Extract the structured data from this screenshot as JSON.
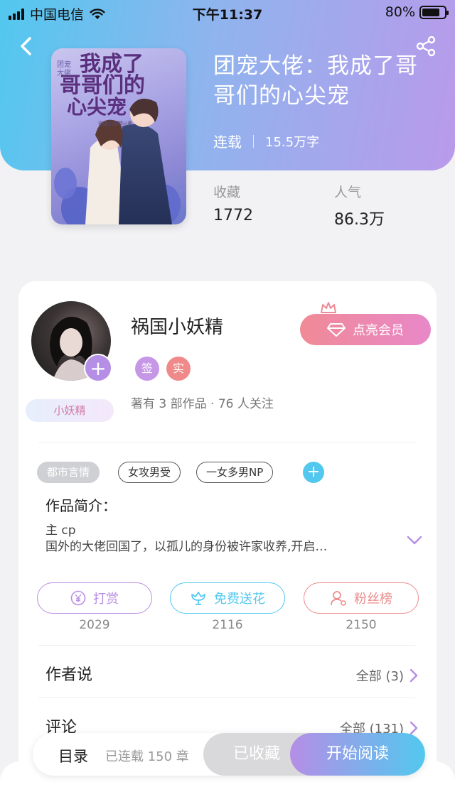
{
  "status_bar": {
    "carrier": "中国电信",
    "time": "下午11:37",
    "battery": "80%",
    "battery_level": 0.8
  },
  "book": {
    "title": "团宠大佬：我成了哥哥们的心尖宠",
    "status": "连载",
    "word_count": "15.5万字",
    "stats": {
      "favorites_label": "收藏",
      "favorites_value": "1772",
      "popularity_label": "人气",
      "popularity_value": "86.3万"
    }
  },
  "author": {
    "name": "祸国小妖精",
    "badge": "小妖精",
    "tag_sign": "签",
    "tag_real": "实",
    "info": "著有 3 部作品 · 76 人关注",
    "vip_button": "点亮会员"
  },
  "tags": [
    "都市言情",
    "女攻男受",
    "一女多男NP"
  ],
  "synopsis": {
    "title": "作品简介：",
    "line1": "主 cp",
    "line2": "国外的大佬回国了，以孤儿的身份被许家收养,开启…"
  },
  "actions": {
    "reward_label": "打赏",
    "reward_count": "2029",
    "flower_label": "免费送花",
    "flower_count": "2116",
    "fans_label": "粉丝榜",
    "fans_count": "2150"
  },
  "sections": {
    "author_says": "作者说",
    "author_says_more": "全部 (3)",
    "comments": "评论",
    "comments_more": "全部 (131)"
  },
  "bottom_bar": {
    "toc": "目录",
    "chapters": "已连载 150 章",
    "collected": "已收藏",
    "start_reading": "开始阅读"
  },
  "colors": {
    "accent_purple": "#b58ee6",
    "accent_blue": "#52c8ef",
    "accent_red": "#ee8b8b"
  },
  "icons": [
    "back-icon",
    "share-icon",
    "wifi-icon",
    "battery-icon",
    "crown-icon",
    "diamond-icon",
    "yen-icon",
    "flower-icon",
    "person-icon",
    "chevron-down-icon",
    "chevron-right-icon"
  ]
}
